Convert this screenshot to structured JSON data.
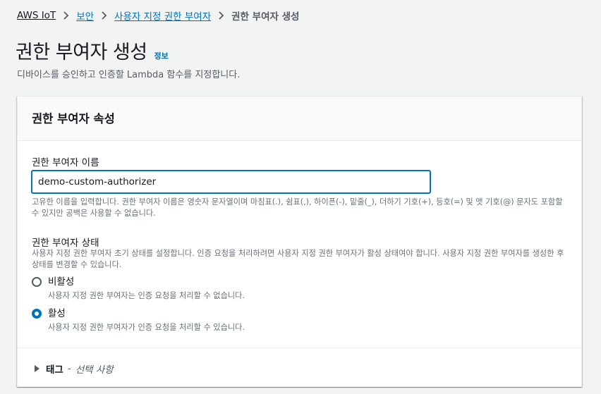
{
  "breadcrumb": {
    "items": [
      "AWS IoT",
      "보안",
      "사용자 지정 권한 부여자"
    ],
    "current": "권한 부여자 생성"
  },
  "header": {
    "title": "권한 부여자 생성",
    "info_link": "정보",
    "description": "디바이스를 승인하고 인증할 Lambda 함수를 지정합니다."
  },
  "panel": {
    "title": "권한 부여자 속성",
    "name_field": {
      "label": "권한 부여자 이름",
      "value": "demo-custom-authorizer",
      "hint": "고유한 이름을 입력합니다. 권한 부여자 이름은 영숫자 문자열이며 마침표(.), 쉼표(,), 하이픈(-), 밑줄(_), 더하기 기호(+), 등호(=) 및 앳 기호(@) 문자도 포함할 수 있지만 공백은 사용할 수 없습니다."
    },
    "status_field": {
      "label": "권한 부여자 상태",
      "description": "사용자 지정 권한 부여자 초기 상태를 설정합니다. 인증 요청을 처리하려면 사용자 지정 권한 부여자가 활성 상태여야 합니다. 사용자 지정 권한 부여자를 생성한 후 상태를 변경할 수 있습니다.",
      "options": [
        {
          "label": "비활성",
          "description": "사용자 지정 권한 부여자는 인증 요청을 처리할 수 없습니다.",
          "selected": false
        },
        {
          "label": "활성",
          "description": "사용자 지정 권한 부여자가 인증 요청을 처리할 수 있습니다.",
          "selected": true
        }
      ]
    },
    "tags": {
      "label": "태그",
      "separator": "-",
      "optional": "선택 사항"
    }
  },
  "colors": {
    "accent": "#0073bb",
    "background": "#f2f3f3",
    "text": "#16191f",
    "muted": "#545b64"
  }
}
